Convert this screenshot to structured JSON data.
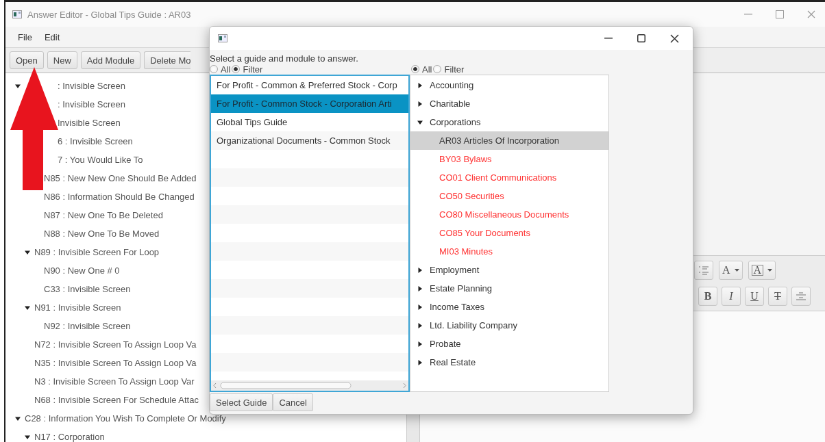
{
  "window": {
    "title": "Answer Editor - Global Tips Guide : AR03"
  },
  "menu": [
    "File",
    "Edit"
  ],
  "toolbar": [
    "Open",
    "New",
    "Add Module",
    "Delete Mo"
  ],
  "outline": [
    {
      "text": ": Invisible Screen",
      "kind": "covered",
      "expanded": true,
      "children": [
        {
          "text": ": Invisible Screen",
          "kind": "covered"
        },
        {
          "text": "Invisible Screen",
          "kind": "covered"
        },
        {
          "text": "6 : Invisible Screen",
          "kind": "covered"
        },
        {
          "text": "7 : You Would Like To",
          "kind": "covered",
          "children": [
            {
              "text": "N85 : New New One Should Be Added"
            },
            {
              "text": "N86 : Information Should Be Changed"
            },
            {
              "text": "N87 : New One To Be Deleted"
            },
            {
              "text": "N88 : New One To Be Moved"
            }
          ]
        },
        {
          "text": "N89 : Invisible Screen For Loop",
          "expanded": true,
          "children": [
            {
              "text": "N90 : New One # 0"
            },
            {
              "text": "C33 : Invisible Screen"
            }
          ]
        },
        {
          "text": "N91 : Invisible Screen",
          "expanded": true,
          "children": [
            {
              "text": "N92 : Invisible Screen"
            }
          ]
        },
        {
          "text": "N72 : Invisible Screen To Assign Loop Va"
        },
        {
          "text": "N35 : Invisible Screen To Assign Loop Va"
        },
        {
          "text": "N3 : Invisible Screen To Assign Loop Var"
        },
        {
          "text": "N68 : Invisible Screen For Schedule Attac"
        }
      ]
    },
    {
      "text": "C28 : Information You Wish To Complete Or Modify",
      "expanded": true,
      "children": [
        {
          "text": "N17 : Corporation",
          "expanded": true
        }
      ]
    }
  ],
  "editor_toolbar": {
    "row_1": [
      {
        "kind": "list"
      },
      {
        "kind": "font_color",
        "label": "A"
      },
      {
        "kind": "highlight",
        "label": "A"
      }
    ],
    "row_2": [
      {
        "kind": "bold",
        "label": "B"
      },
      {
        "kind": "italic",
        "label": "I"
      },
      {
        "kind": "underline",
        "label": "U"
      },
      {
        "kind": "strike",
        "label": "T"
      },
      {
        "kind": "align"
      }
    ]
  },
  "dialog": {
    "prompt": "Select a guide and module to answer.",
    "guide_filter": [
      {
        "label": "All",
        "selected": false
      },
      {
        "label": "Filter",
        "selected": true
      }
    ],
    "module_filter": [
      {
        "label": "All",
        "selected": true
      },
      {
        "label": "Filter",
        "selected": false
      }
    ],
    "guides": [
      {
        "text": "For Profit - Common & Preferred Stock - Corp",
        "selected": false
      },
      {
        "text": "For Profit - Common Stock - Corporation Arti",
        "selected": true
      },
      {
        "text": "Global Tips Guide",
        "selected": false
      },
      {
        "text": "Organizational Documents - Common Stock",
        "selected": false
      }
    ],
    "modules": [
      {
        "label": "Accounting",
        "expanded": false
      },
      {
        "label": "Charitable",
        "expanded": false
      },
      {
        "label": "Corporations",
        "expanded": true,
        "children": [
          {
            "label": "AR03 Articles Of Incorporation",
            "selected": true,
            "color": "#333333"
          },
          {
            "label": "BY03 Bylaws",
            "selected": false,
            "color": "#ff3030"
          },
          {
            "label": "CO01 Client Communications",
            "selected": false,
            "color": "#ff3030"
          },
          {
            "label": "CO50 Securities",
            "selected": false,
            "color": "#ff3030"
          },
          {
            "label": "CO80 Miscellaneous Documents",
            "selected": false,
            "color": "#ff3030"
          },
          {
            "label": "CO85 Your Documents",
            "selected": false,
            "color": "#ff3030"
          },
          {
            "label": "MI03 Minutes",
            "selected": false,
            "color": "#ff3030"
          }
        ]
      },
      {
        "label": "Employment",
        "expanded": false
      },
      {
        "label": "Estate Planning",
        "expanded": false
      },
      {
        "label": "Income Taxes",
        "expanded": false
      },
      {
        "label": "Ltd. Liability Company",
        "expanded": false
      },
      {
        "label": "Probate",
        "expanded": false
      },
      {
        "label": "Real Estate",
        "expanded": false
      }
    ],
    "buttons": [
      "Select Guide",
      "Cancel"
    ]
  }
}
